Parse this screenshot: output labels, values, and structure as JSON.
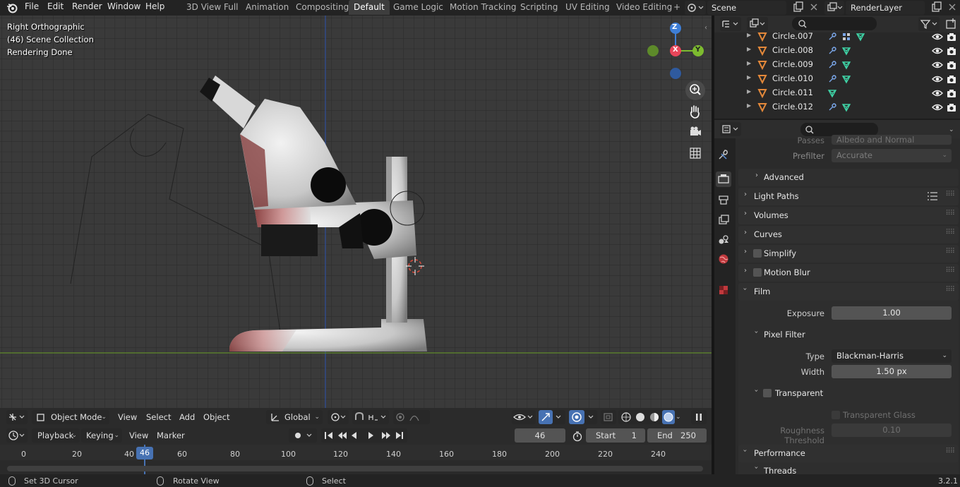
{
  "menu": [
    "File",
    "Edit",
    "Render",
    "Window",
    "Help"
  ],
  "workspaces": [
    "3D View Full",
    "Animation",
    "Compositing",
    "Default",
    "Game Logic",
    "Motion Tracking",
    "Scripting",
    "UV Editing",
    "Video Editing"
  ],
  "active_workspace": "Default",
  "add_workspace": "+",
  "scene_name": "Scene",
  "view_layer": "RenderLayer",
  "viewport": {
    "view_name": "Right Orthographic",
    "collection": "(46) Scene Collection",
    "status": "Rendering Done",
    "gizmo": {
      "z": "Z",
      "x": "X",
      "y": "Y"
    }
  },
  "outliner": {
    "items": [
      "Circle.007",
      "Circle.008",
      "Circle.009",
      "Circle.010",
      "Circle.011",
      "Circle.012"
    ]
  },
  "properties": {
    "passes_label": "Passes",
    "passes_value": "Albedo and Normal",
    "prefilter_label": "Prefilter",
    "prefilter_value": "Accurate",
    "advanced": "Advanced",
    "panels": [
      "Light Paths",
      "Volumes",
      "Curves",
      "Simplify",
      "Motion Blur",
      "Film"
    ],
    "exposure_label": "Exposure",
    "exposure_value": "1.00",
    "pixel_filter": "Pixel Filter",
    "type_label": "Type",
    "type_value": "Blackman-Harris",
    "width_label": "Width",
    "width_value": "1.50 px",
    "transparent": "Transparent",
    "transparent_glass": "Transparent Glass",
    "roughness_label": "Roughness Threshold",
    "roughness_value": "0.10",
    "performance": "Performance",
    "threads": "Threads"
  },
  "view3d_header": {
    "mode": "Object Mode",
    "menus": [
      "View",
      "Select",
      "Add",
      "Object"
    ],
    "orientation": "Global"
  },
  "timeline": {
    "menus": [
      "Playback",
      "Keying",
      "View",
      "Marker"
    ],
    "current_frame": "46",
    "start_label": "Start",
    "start_value": "1",
    "end_label": "End",
    "end_value": "250",
    "ticks": [
      "0",
      "20",
      "40",
      "60",
      "80",
      "100",
      "120",
      "140",
      "160",
      "180",
      "200",
      "220",
      "240"
    ],
    "playhead": "46"
  },
  "statusbar": {
    "left": "Set 3D Cursor",
    "middle": "Rotate View",
    "right": "Select",
    "version": "3.2.1"
  },
  "colors": {
    "accent": "#4772b3",
    "x_axis": "#e8465a",
    "y_axis": "#7dbb2f",
    "z_axis": "#3e7ed6",
    "object_orange": "#e3883a"
  }
}
